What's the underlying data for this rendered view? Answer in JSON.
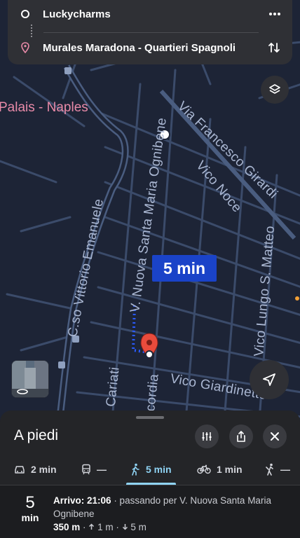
{
  "route": {
    "origin": "Luckycharms",
    "destination": "Murales Maradona - Quartieri Spagnoli",
    "more_icon": "more-horizontal-icon",
    "swap_icon": "swap-vertical-icon"
  },
  "map": {
    "poi_label": "Palais - Naples",
    "streets": [
      "Via Francesco Girardi",
      "Vico Noce",
      "V. Nuova Santa Maria Ognibene",
      "C.so Vittorio Emanuele",
      "Vico Lungo S. Matteo",
      "Vico Giardinetto",
      "ncordia",
      "o Cariati"
    ],
    "duration_label": "5 min",
    "route_color": "#2a5bff",
    "pin_color": "#e94b3c"
  },
  "sheet": {
    "title": "A piedi",
    "modes": [
      {
        "icon": "car-icon",
        "label": "2 min"
      },
      {
        "icon": "transit-icon",
        "label": "—"
      },
      {
        "icon": "walk-icon",
        "label": "5 min"
      },
      {
        "icon": "bike-icon",
        "label": "1 min"
      },
      {
        "icon": "ride-icon",
        "label": "—"
      }
    ],
    "active_mode": "walk",
    "result": {
      "eta_number": "5",
      "eta_unit": "min",
      "arrival": "Arrivo: 21:06",
      "via": "· passando per V. Nuova Santa Maria Ognibene",
      "distance": "350 m",
      "ascent": "1 m",
      "descent": "5 m"
    }
  }
}
